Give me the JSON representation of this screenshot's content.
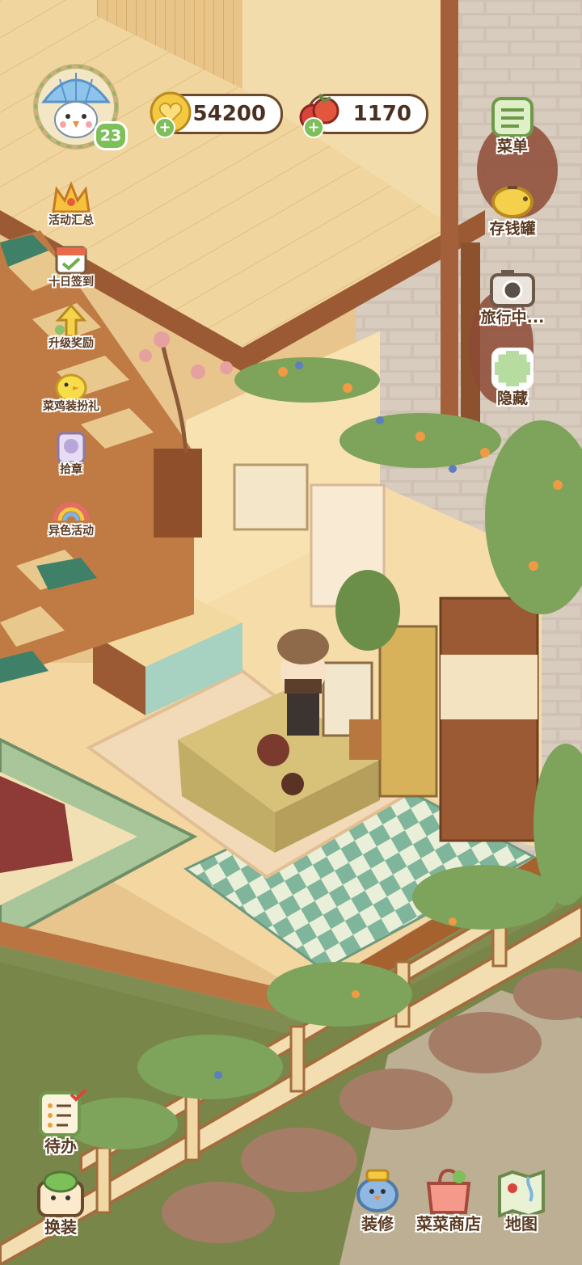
{
  "player": {
    "level": "23"
  },
  "currencies": {
    "coins": "54200",
    "tomatoes": "1170"
  },
  "left_menu": {
    "events_summary": "活动汇总",
    "ten_day_checkin": "十日签到",
    "level_rewards": "升级奖励",
    "chick_dressup": "菜鸡装扮礼",
    "badges": "拾章",
    "alt_color_event": "异色活动"
  },
  "right_menu": {
    "menu": "菜单",
    "piggy_bank": "存钱罐",
    "traveling": "旅行中...",
    "hide": "隐藏"
  },
  "bottom_menu": {
    "todo": "待办",
    "outfit": "换装",
    "decorate": "装修",
    "shop": "菜菜商店",
    "map": "地图"
  },
  "colors": {
    "outline_brown": "#6b4a2c",
    "accent_green": "#7dbf58",
    "floor_wood": "#f0d49a",
    "grass": "#7c8a4f",
    "stone_path": "#c9b7a2"
  }
}
